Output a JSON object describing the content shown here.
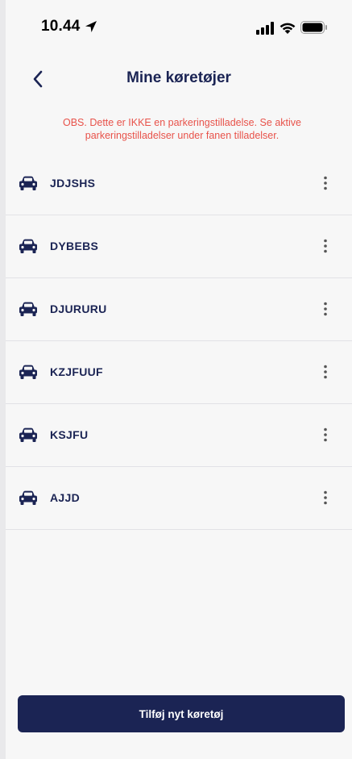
{
  "status_bar": {
    "time": "10.44"
  },
  "header": {
    "title": "Mine køretøjer"
  },
  "notice": "OBS. Dette er IKKE en parkeringstilladelse. Se aktive parkeringstilladelser under fanen tilladelser.",
  "vehicles": [
    {
      "plate": "JDJSHS"
    },
    {
      "plate": "DYBEBS"
    },
    {
      "plate": "DJURURU"
    },
    {
      "plate": "KZJFUUF"
    },
    {
      "plate": "KSJFU"
    },
    {
      "plate": "AJJD"
    }
  ],
  "add_button": {
    "label": "Tilføj nyt køretøj"
  },
  "colors": {
    "primary": "#1b2454",
    "warning": "#e8524a",
    "background": "#f7f7f7",
    "divider": "#e2e2e6"
  },
  "icons": {
    "back": "chevron-left-icon",
    "vehicle": "car-icon",
    "more": "more-vertical-icon",
    "location": "location-arrow-icon"
  }
}
